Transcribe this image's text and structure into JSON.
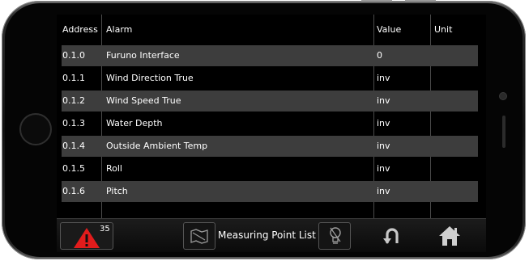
{
  "table": {
    "headers": {
      "address": "Address",
      "alarm": "Alarm",
      "value": "Value",
      "unit": "Unit"
    },
    "rows": [
      {
        "address": "0.1.0",
        "alarm": "Furuno Interface",
        "value": "0",
        "unit": ""
      },
      {
        "address": "0.1.1",
        "alarm": "Wind Direction True",
        "value": "inv",
        "unit": ""
      },
      {
        "address": "0.1.2",
        "alarm": "Wind Speed True",
        "value": "inv",
        "unit": ""
      },
      {
        "address": "0.1.3",
        "alarm": "Water Depth",
        "value": "inv",
        "unit": ""
      },
      {
        "address": "0.1.4",
        "alarm": "Outside Ambient Temp",
        "value": "inv",
        "unit": ""
      },
      {
        "address": "0.1.5",
        "alarm": "Roll",
        "value": "inv",
        "unit": ""
      },
      {
        "address": "0.1.6",
        "alarm": "Pitch",
        "value": "inv",
        "unit": ""
      }
    ]
  },
  "toolbar": {
    "alarm_count": "35",
    "title": "Measuring Point List",
    "icons": [
      "alarm-warning-icon",
      "map-icon",
      "lightbulb-icon",
      "back-icon",
      "home-icon"
    ]
  },
  "colors": {
    "alarm_red": "#e21c1c",
    "row_alt": "#3d3d3d",
    "screen_bg": "#000000"
  }
}
